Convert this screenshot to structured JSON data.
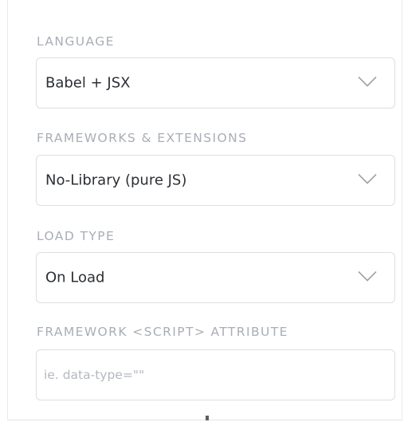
{
  "language": {
    "label": "LANGUAGE",
    "selected": "Babel + JSX",
    "icon": "chevron-down-icon"
  },
  "frameworks": {
    "label": "FRAMEWORKS & EXTENSIONS",
    "selected": "No-Library (pure JS)",
    "icon": "chevron-down-icon"
  },
  "load_type": {
    "label": "LOAD TYPE",
    "selected": "On Load",
    "icon": "chevron-down-icon"
  },
  "script_attribute": {
    "label": "FRAMEWORK <SCRIPT> ATTRIBUTE",
    "value": "",
    "placeholder": "ie. data-type=\"\""
  },
  "colors": {
    "label_text": "#a9aeb6",
    "value_text": "#2c2f34",
    "border": "#dcdee2",
    "placeholder": "#b4b8bf",
    "chevron": "#9aa0a8"
  }
}
